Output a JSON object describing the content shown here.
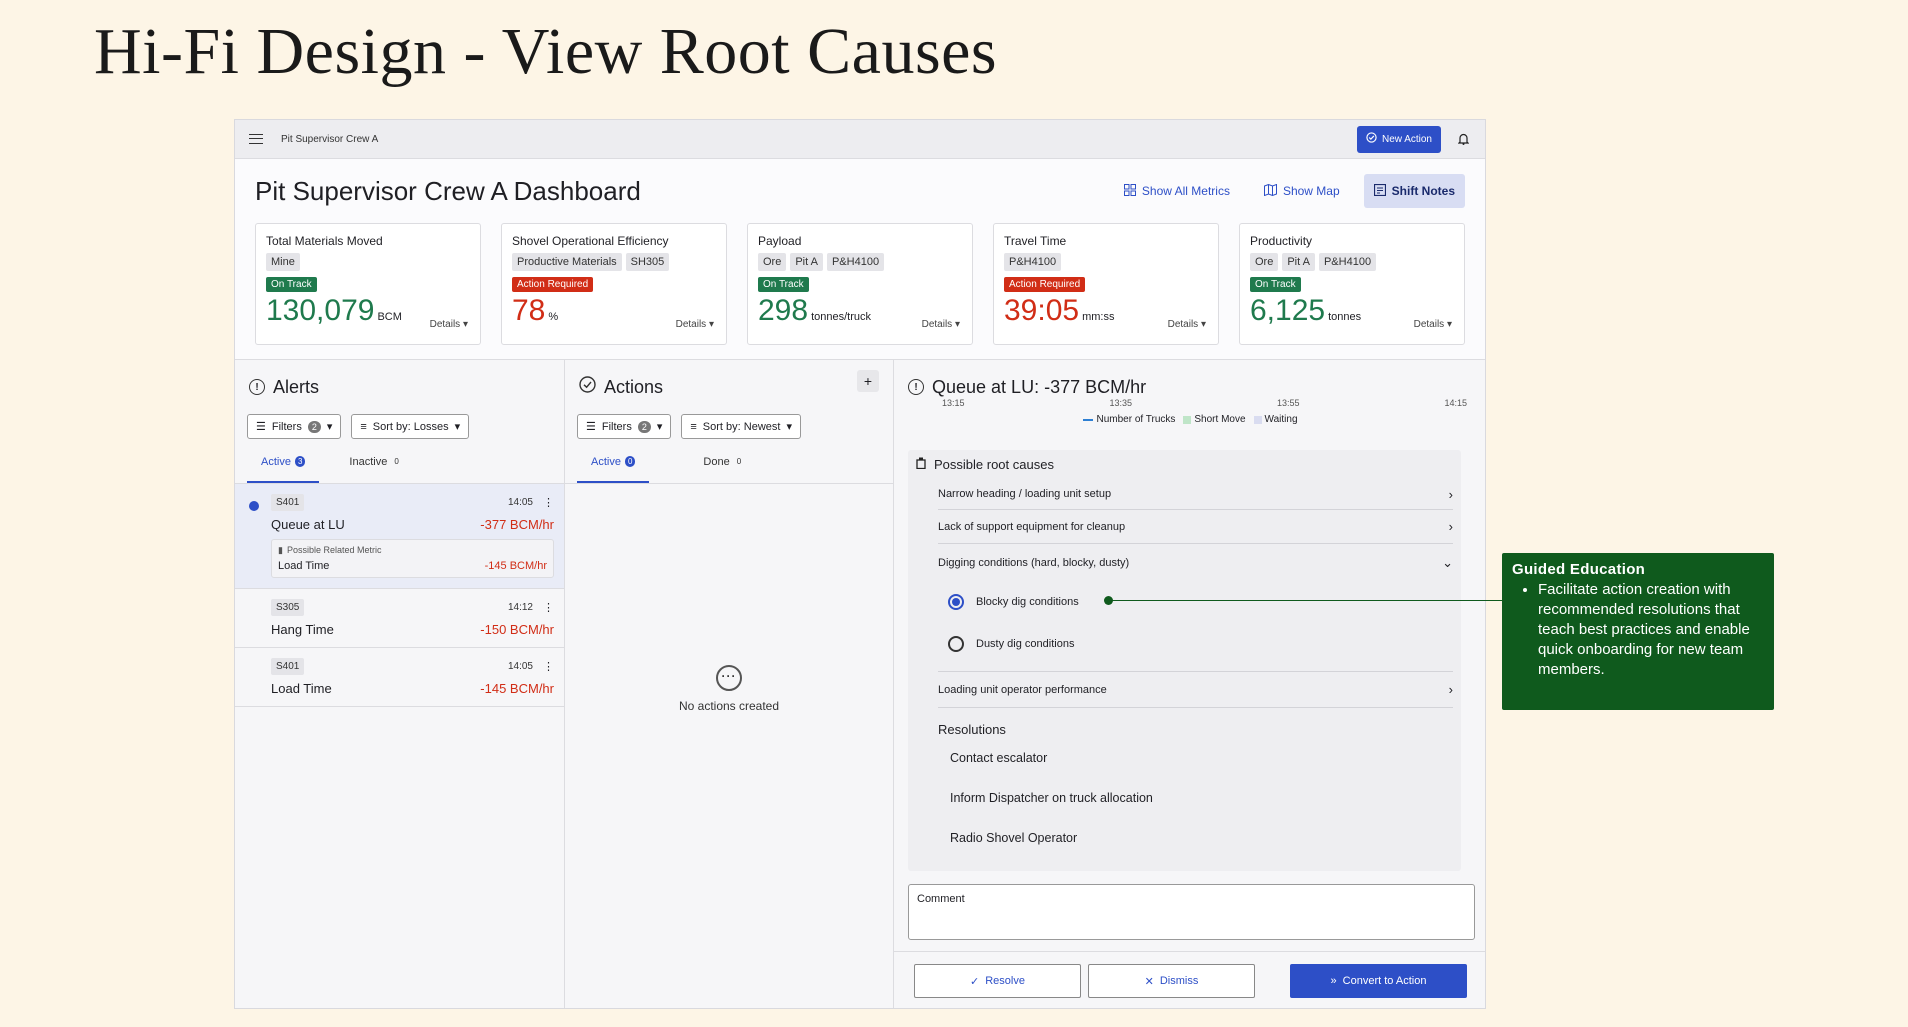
{
  "slide_title": "Hi-Fi Design - View Root Causes",
  "topbar": {
    "crumb": "Pit Supervisor Crew A",
    "new_action": "New Action"
  },
  "header": {
    "title": "Pit Supervisor Crew A Dashboard",
    "links": [
      "Show All Metrics",
      "Show Map",
      "Shift Notes"
    ]
  },
  "metrics": [
    {
      "title": "Total Materials Moved",
      "chips": [
        "Mine"
      ],
      "status": "On Track",
      "status_type": "ok",
      "value": "130,079",
      "unit": "BCM",
      "details": "Details"
    },
    {
      "title": "Shovel Operational Efficiency",
      "chips": [
        "Productive Materials",
        "SH305"
      ],
      "status": "Action Required",
      "status_type": "bad",
      "value": "78",
      "unit": "%",
      "details": "Details"
    },
    {
      "title": "Payload",
      "chips": [
        "Ore",
        "Pit A",
        "P&H4100"
      ],
      "status": "On Track",
      "status_type": "ok",
      "value": "298",
      "unit": "tonnes/truck",
      "details": "Details"
    },
    {
      "title": "Travel Time",
      "chips": [
        "P&H4100"
      ],
      "status": "Action Required",
      "status_type": "bad",
      "value": "39:05",
      "unit": "mm:ss",
      "details": "Details"
    },
    {
      "title": "Productivity",
      "chips": [
        "Ore",
        "Pit A",
        "P&H4100"
      ],
      "status": "On Track",
      "status_type": "ok",
      "value": "6,125",
      "unit": "tonnes",
      "details": "Details"
    }
  ],
  "alerts": {
    "title": "Alerts",
    "filters_label": "Filters",
    "filters_count": "2",
    "sort_label": "Sort by: Losses",
    "tab_active": "Active",
    "tab_active_count": "3",
    "tab_inactive": "Inactive",
    "tab_inactive_count": "0",
    "items": [
      {
        "chip": "S401",
        "time": "14:05",
        "name": "Queue at LU",
        "value": "-377 BCM/hr",
        "related_label": "Possible Related Metric",
        "related_name": "Load Time",
        "related_value": "-145 BCM/hr"
      },
      {
        "chip": "S305",
        "time": "14:12",
        "name": "Hang Time",
        "value": "-150 BCM/hr"
      },
      {
        "chip": "S401",
        "time": "14:05",
        "name": "Load Time",
        "value": "-145 BCM/hr"
      }
    ]
  },
  "actions": {
    "title": "Actions",
    "filters_label": "Filters",
    "filters_count": "2",
    "sort_label": "Sort by: Newest",
    "tab_active": "Active",
    "tab_active_count": "0",
    "tab_done": "Done",
    "tab_done_count": "0",
    "empty_text": "No actions created"
  },
  "detail": {
    "title": "Queue at LU: -377 BCM/hr",
    "ticks": [
      "13:15",
      "13:35",
      "13:55",
      "14:15"
    ],
    "legend": [
      "Number of Trucks",
      "Short Move",
      "Waiting"
    ],
    "root_causes_title": "Possible root causes",
    "causes": [
      "Narrow heading / loading unit setup",
      "Lack of support equipment for cleanup",
      "Digging conditions (hard, blocky, dusty)"
    ],
    "options": [
      "Blocky dig conditions",
      "Dusty dig conditions"
    ],
    "cause_last": "Loading unit operator performance",
    "resolutions_title": "Resolutions",
    "resolutions": [
      "Contact escalator",
      "Inform Dispatcher on truck allocation",
      "Radio Shovel Operator"
    ],
    "comment_label": "Comment",
    "resolve": "Resolve",
    "dismiss": "Dismiss",
    "convert": "Convert to Action"
  },
  "education": {
    "title": "Guided Education",
    "bullet": "Facilitate action creation with recommended resolutions that teach best practices and enable quick onboarding for new team members."
  }
}
